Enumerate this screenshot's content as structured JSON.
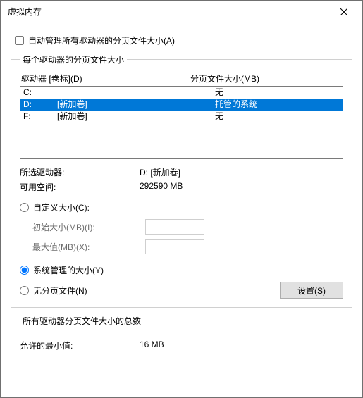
{
  "title": "虚拟内存",
  "auto_manage_label": "自动管理所有驱动器的分页文件大小(A)",
  "group_drives_title": "每个驱动器的分页文件大小",
  "col_drive": "驱动器 [卷标](D)",
  "col_paging": "分页文件大小(MB)",
  "drives": [
    {
      "letter": "C:",
      "label": "",
      "paging": "无",
      "selected": false
    },
    {
      "letter": "D:",
      "label": "[新加卷]",
      "paging": "托管的系统",
      "selected": true
    },
    {
      "letter": "F:",
      "label": "[新加卷]",
      "paging": "无",
      "selected": false
    }
  ],
  "selected_drive_label": "所选驱动器:",
  "selected_drive_value": "D:  [新加卷]",
  "free_space_label": "可用空间:",
  "free_space_value": "292590 MB",
  "opt_custom": "自定义大小(C):",
  "initial_label": "初始大小(MB)(I):",
  "max_label": "最大值(MB)(X):",
  "opt_system": "系统管理的大小(Y)",
  "opt_none": "无分页文件(N)",
  "set_button": "设置(S)",
  "group_totals_title": "所有驱动器分页文件大小的总数",
  "min_allowed_label": "允许的最小值:",
  "min_allowed_value": "16 MB"
}
